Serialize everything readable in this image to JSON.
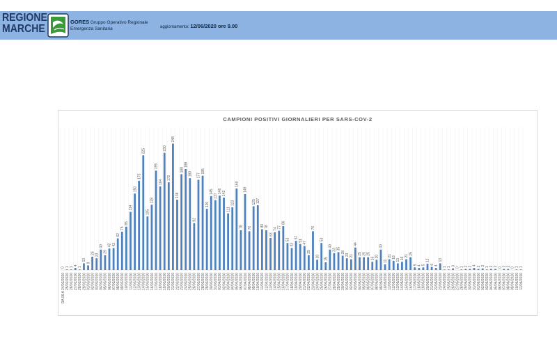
{
  "header": {
    "logo_line1": "REGIONE",
    "logo_line2": "MARCHE",
    "gores": "GORES",
    "gores_desc_1": "Gruppo Operativo Regionale",
    "gores_desc_2": "Emergenza Sanitaria",
    "update_label": "aggiornamento:",
    "update_value": "12/06/2020 ore 9.00"
  },
  "colors": {
    "header_bg": "#8db3e2",
    "logo_text": "#1f3864",
    "emblem_green": "#3a9a3a",
    "bar": "#4f81bd",
    "label": "#595959",
    "gridline": "#ededed",
    "axis": "#d9d9d9"
  },
  "icons": {
    "emblem": "regione-marche-emblem-icon"
  },
  "chart_data": {
    "type": "bar",
    "title": "CAMPIONI POSITIVI GIORNALIERI PER SARS-COV-2",
    "ylim": [
      0,
      280
    ],
    "grid": {
      "vertical": true,
      "horizontal": false
    },
    "data_labels": true,
    "categories": [
      "DA 06 A 24/02/2020",
      "25/02/2020",
      "26/02/2020",
      "27/02/2020",
      "28/02/2020",
      "29/02/2020",
      "01/03/2020",
      "02/03/2020",
      "03/03/2020",
      "04/03/2020",
      "05/03/2020",
      "06/03/2020",
      "07/03/2020",
      "08/03/2020",
      "09/03/2020",
      "10/03/2020",
      "11/03/2020",
      "12/03/2020",
      "13/03/2020",
      "14/03/2020",
      "15/03/2020",
      "16/03/2020",
      "17/03/2020",
      "18/03/2020",
      "19/03/2020",
      "20/03/2020",
      "21/03/2020",
      "22/03/2020",
      "23/03/2020",
      "24/03/2020",
      "25/03/2020",
      "26/03/2020",
      "27/03/2020",
      "28/03/2020",
      "29/03/2020",
      "30/03/2020",
      "31/03/2020",
      "01/04/2020",
      "02/04/2020",
      "03/04/2020",
      "04/04/2020",
      "05/04/2020",
      "06/04/2020",
      "07/04/2020",
      "08/04/2020",
      "09/04/2020",
      "10/04/2020",
      "11/04/2020",
      "12/04/2020",
      "13/04/2020",
      "14/04/2020",
      "15/04/2020",
      "16/04/2020",
      "17/04/2020",
      "18/04/2020",
      "19/04/2020",
      "20/04/2020",
      "21/04/2020",
      "22/04/2020",
      "23/04/2020",
      "24/04/2020",
      "25/04/2020",
      "26/04/2020",
      "27/04/2020",
      "28/04/2020",
      "29/04/2020",
      "30/04/2020",
      "01/05/2020",
      "02/05/2020",
      "03/05/2020",
      "04/05/2020",
      "05/05/2020",
      "06/05/2020",
      "07/05/2020",
      "08/05/2020",
      "09/05/2020",
      "10/05/2020",
      "11/05/2020",
      "12/05/2020",
      "13/05/2020",
      "14/05/2020",
      "15/05/2020",
      "16/05/2020",
      "17/05/2020",
      "18/05/2020",
      "19/05/2020",
      "20/05/2020",
      "21/05/2020",
      "22/05/2020",
      "23/05/2020",
      "24/05/2020",
      "25/05/2020",
      "26/05/2020",
      "27/05/2020",
      "28/05/2020",
      "29/05/2020",
      "30/05/2020",
      "31/05/2020",
      "01/06/2020",
      "02/06/2020",
      "03/06/2020",
      "04/06/2020",
      "05/06/2020",
      "06/06/2020",
      "07/06/2020",
      "08/06/2020",
      "09/06/2020",
      "10/06/2020",
      "11/06/2020"
    ],
    "values": [
      0,
      1,
      1,
      4,
      1,
      13,
      9,
      26,
      23,
      40,
      29,
      42,
      43,
      62,
      75,
      85,
      114,
      150,
      175,
      225,
      105,
      128,
      195,
      164,
      230,
      172,
      248,
      138,
      188,
      198,
      180,
      92,
      177,
      185,
      120,
      145,
      137,
      146,
      142,
      111,
      123,
      160,
      78,
      149,
      76,
      125,
      127,
      80,
      78,
      63,
      74,
      77,
      86,
      53,
      43,
      57,
      51,
      47,
      29,
      76,
      20,
      53,
      15,
      40,
      33,
      35,
      28,
      23,
      21,
      44,
      25,
      25,
      25,
      16,
      20,
      40,
      11,
      21,
      18,
      13,
      16,
      21,
      25,
      5,
      4,
      5,
      12,
      6,
      4,
      13,
      1,
      1,
      3,
      0,
      1,
      2,
      2,
      4,
      2,
      3,
      1,
      2,
      2,
      0,
      2,
      2,
      0,
      1,
      1
    ]
  }
}
